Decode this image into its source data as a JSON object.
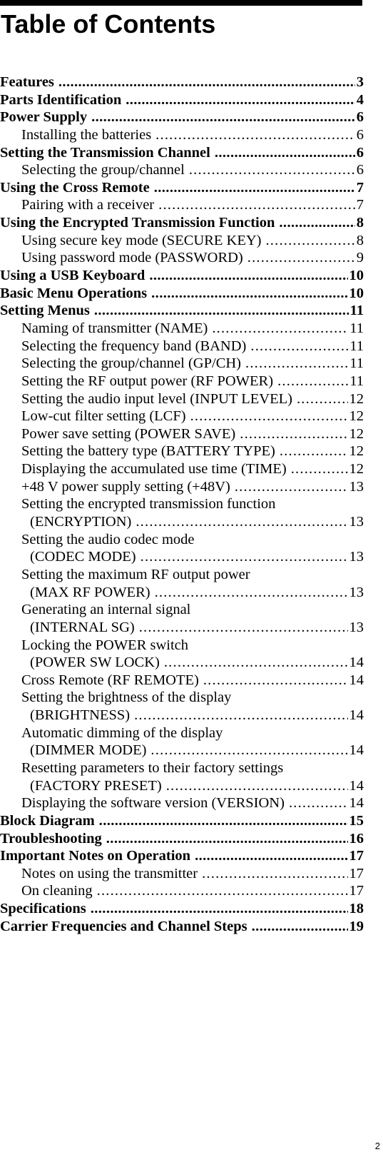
{
  "title": "Table of Contents",
  "page_number": "2",
  "entries": [
    {
      "level": 1,
      "label": "Features",
      "page": "3"
    },
    {
      "level": 1,
      "label": "Parts Identification",
      "page": "4"
    },
    {
      "level": 1,
      "label": "Power Supply",
      "page": "6"
    },
    {
      "level": 2,
      "label": "Installing the batteries",
      "page": "6"
    },
    {
      "level": 1,
      "label": "Setting the Transmission Channel",
      "page": "6"
    },
    {
      "level": 2,
      "label": "Selecting the group/channel",
      "page": "6"
    },
    {
      "level": 1,
      "label": "Using the Cross Remote",
      "page": "7"
    },
    {
      "level": 2,
      "label": "Pairing with a receiver",
      "page": "7"
    },
    {
      "level": 1,
      "label": "Using the Encrypted Transmission Function",
      "page": "8"
    },
    {
      "level": 2,
      "label": "Using secure key mode (SECURE KEY)",
      "page": "8"
    },
    {
      "level": 2,
      "label": "Using password mode (PASSWORD)",
      "page": "9"
    },
    {
      "level": 1,
      "label": "Using a USB Keyboard",
      "page": "10"
    },
    {
      "level": 1,
      "label": "Basic Menu Operations",
      "page": "10"
    },
    {
      "level": 1,
      "label": "Setting Menus",
      "page": "11"
    },
    {
      "level": 2,
      "label": "Naming of transmitter (NAME)",
      "page": "11"
    },
    {
      "level": 2,
      "label": "Selecting the frequency band (BAND)",
      "page": "11"
    },
    {
      "level": 2,
      "label": "Selecting the group/channel (GP/CH)",
      "page": "11"
    },
    {
      "level": 2,
      "label": "Setting the RF output power (RF POWER)",
      "page": "11"
    },
    {
      "level": 2,
      "label": "Setting the audio input level (INPUT LEVEL)",
      "page": "12"
    },
    {
      "level": 2,
      "label": "Low-cut filter setting (LCF)",
      "page": "12"
    },
    {
      "level": 2,
      "label": "Power save setting (POWER SAVE)",
      "page": "12"
    },
    {
      "level": 2,
      "label": "Setting the battery type (BATTERY TYPE)",
      "page": "12"
    },
    {
      "level": 2,
      "label": "Displaying the accumulated use time (TIME)",
      "page": "12"
    },
    {
      "level": 2,
      "label": "+48 V power supply setting (+48V)",
      "page": "13"
    },
    {
      "level": 2,
      "label": "Setting the encrypted transmission function",
      "label2": "(ENCRYPTION)",
      "page": "13"
    },
    {
      "level": 2,
      "label": "Setting the audio codec mode",
      "label2": "(CODEC MODE)",
      "page": "13"
    },
    {
      "level": 2,
      "label": "Setting the maximum RF output power",
      "label2": "(MAX RF POWER)",
      "page": "13"
    },
    {
      "level": 2,
      "label": "Generating an internal signal",
      "label2": "(INTERNAL SG)",
      "page": "13"
    },
    {
      "level": 2,
      "label": "Locking the POWER switch",
      "label2": "(POWER SW LOCK)",
      "page": "14"
    },
    {
      "level": 2,
      "label": "Cross Remote (RF REMOTE)",
      "page": "14"
    },
    {
      "level": 2,
      "label": "Setting the brightness of the display",
      "label2": "(BRIGHTNESS)",
      "page": "14"
    },
    {
      "level": 2,
      "label": "Automatic dimming of the display",
      "label2": "(DIMMER MODE)",
      "page": "14"
    },
    {
      "level": 2,
      "label": "Resetting parameters to their factory settings",
      "label2": "(FACTORY PRESET)",
      "page": "14"
    },
    {
      "level": 2,
      "label": "Displaying the software version (VERSION)",
      "page": "14"
    },
    {
      "level": 1,
      "label": "Block Diagram",
      "page": "15"
    },
    {
      "level": 1,
      "label": "Troubleshooting",
      "page": "16"
    },
    {
      "level": 1,
      "label": "Important Notes on Operation",
      "page": "17"
    },
    {
      "level": 2,
      "label": "Notes on using the transmitter",
      "page": "17"
    },
    {
      "level": 2,
      "label": "On cleaning",
      "page": "17"
    },
    {
      "level": 1,
      "label": "Specifications",
      "page": "18"
    },
    {
      "level": 1,
      "label": "Carrier Frequencies and Channel Steps",
      "page": "19"
    }
  ]
}
